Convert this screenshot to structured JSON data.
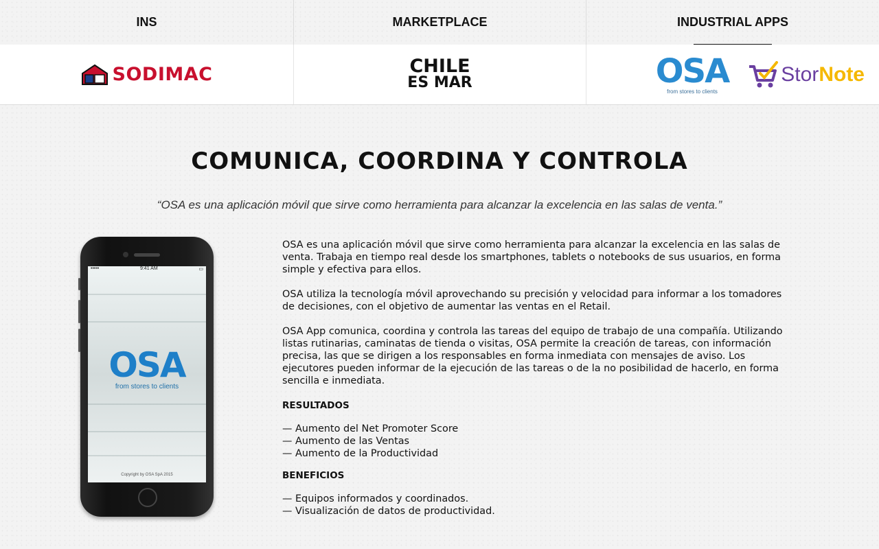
{
  "tabs": [
    {
      "label": "INS",
      "active": false
    },
    {
      "label": "MARKETPLACE",
      "active": false
    },
    {
      "label": "INDUSTRIAL APPS",
      "active": true
    }
  ],
  "logos": {
    "sodimac": "SODIMAC",
    "chile_line1": "CHILE",
    "chile_line2": "ES MAR",
    "osa": "OSA",
    "osa_tagline": "from stores to clients",
    "stornote_1": "Stor",
    "stornote_2": "Note"
  },
  "main": {
    "title": "COMUNICA, COORDINA Y CONTROLA",
    "quote": "“OSA es una aplicación móvil que sirve como herramienta para alcanzar la excelencia en las salas de venta.”",
    "paragraphs": [
      "OSA es una aplicación móvil que sirve como herramienta para alcanzar la excelencia en las salas de venta. Trabaja en tiempo real desde los smartphones, tablets o notebooks de sus usuarios, en forma simple y efectiva para ellos.",
      "OSA utiliza la tecnología móvil aprovechando su precisión y velocidad para informar a los tomadores de decisiones, con el objetivo de aumentar las ventas en el Retail.",
      "OSA App comunica, coordina y controla las tareas del equipo de trabajo de una compañía. Utilizando listas rutinarias, caminatas de tienda o visitas, OSA permite la creación de tareas, con información precisa, las que se dirigen a los responsables en forma inmediata con mensajes de aviso. Los ejecutores pueden informar de la ejecución de las tareas o de la no posibilidad de hacerlo, en forma sencilla e inmediata."
    ],
    "results_heading": "RESULTADOS",
    "results": [
      "— Aumento del Net Promoter Score",
      "— Aumento de las Ventas",
      "— Aumento de la Productividad"
    ],
    "benefits_heading": "BENEFICIOS",
    "benefits": [
      "— Equipos informados y coordinados.",
      "— Visualización de datos de productividad."
    ]
  },
  "phone": {
    "time": "9:41 AM",
    "signal": "•••••",
    "app_name": "OSA",
    "app_tagline": "from stores to clients",
    "copyright": "Copyright by OSA SpA 2015"
  },
  "colors": {
    "sodimac_red": "#c8102e",
    "osa_blue": "#2a8bd0",
    "stornote_purple": "#6a3fa0",
    "stornote_yellow": "#f5b800"
  }
}
